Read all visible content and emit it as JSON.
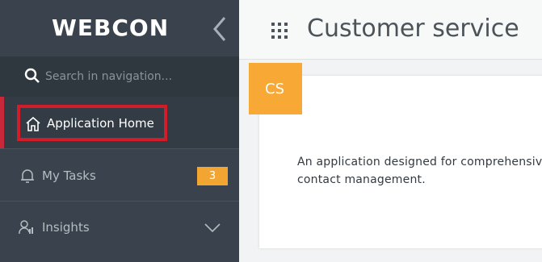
{
  "sidebar": {
    "logo_text": "WEBCON",
    "collapse_icon": "chevron-left-icon",
    "search": {
      "placeholder": "Search in navigation..."
    },
    "items": [
      {
        "label": "Application Home",
        "icon": "home-icon"
      },
      {
        "label": "My Tasks",
        "icon": "bell-icon",
        "badge": "3"
      },
      {
        "label": "Insights",
        "icon": "user-chart-icon",
        "expand_icon": "chevron-down-icon"
      }
    ]
  },
  "header": {
    "apps_icon": "grid-icon",
    "title": "Customer service"
  },
  "app_card": {
    "tile_text": "CS",
    "description": "An application designed for comprehensive contact management."
  },
  "colors": {
    "sidebar_bg": "#3a434d",
    "search_bg": "#2f373f",
    "active_marker": "#c8283a",
    "highlight_box": "#d11d2a",
    "badge_bg": "#f3a531",
    "tile_bg": "#f7a835"
  }
}
